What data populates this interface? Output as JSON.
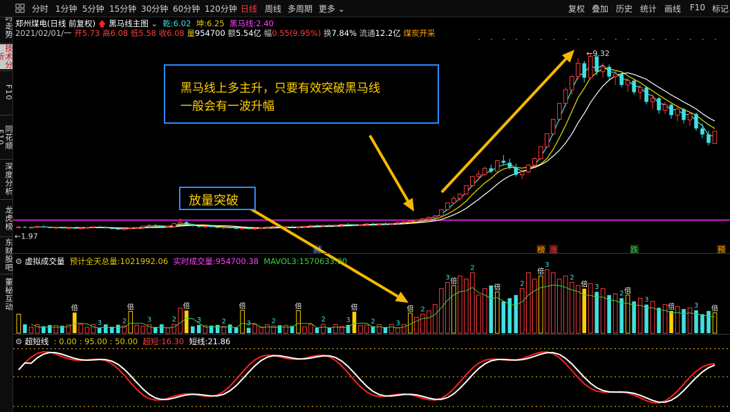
{
  "toolbar": {
    "items": [
      "分时",
      "1分钟",
      "5分钟",
      "15分钟",
      "30分钟",
      "60分钟",
      "120分钟",
      "日线",
      "周线",
      "多周期",
      "更多"
    ],
    "active": "日线",
    "right_items": [
      "复权",
      "叠加",
      "历史",
      "统计",
      "画线",
      "F10",
      "标记"
    ]
  },
  "leftnav": {
    "items": [
      "分时走势",
      "技术分析",
      "F10",
      "同花顺F10",
      "深度分析",
      "龙虎榜",
      "东财股吧",
      "董秘互动"
    ]
  },
  "stock": {
    "name": "郑州煤电",
    "mode": "(日线 前复权)",
    "indicator": "黑马线主图",
    "qian_label": "乾:",
    "qian": "6.02",
    "kun_label": "坤:",
    "kun": "6.25",
    "heima_label": "黑马线:",
    "heima": "2.40"
  },
  "quote": {
    "date": "2021/02/01/一",
    "open_label": "开",
    "open": "5.73",
    "high_label": "高",
    "high": "6.08",
    "low_label": "低",
    "low": "5.58",
    "close_label": "收",
    "close": "6.08",
    "vol_label": "量",
    "vol": "954700",
    "amt_label": "额",
    "amt": "5.54亿",
    "chg_label": "幅",
    "chg": "0.55(9.95%)",
    "turn_label": "换",
    "turn": "7.84%",
    "float_label": "流通",
    "float": "12.2亿",
    "sector": "煤炭开采"
  },
  "main_chart": {
    "high_label": "9.32",
    "low_label": "1.97",
    "markers": [
      "财",
      "榜",
      "涨",
      "跌",
      "预"
    ]
  },
  "callouts": {
    "big_line1": "黑马线上多主升，只要有效突破黑马线",
    "big_line2": "一般会有一波升幅",
    "small": "放量突破"
  },
  "volume_panel": {
    "title": "虚拟成交量",
    "est_label": "预计全天总量:",
    "est": "1021992.06",
    "rt_label": "实时成交量:",
    "rt": "954700.38",
    "mavol_label": "MAVOL3:",
    "mavol": "1570633.00",
    "mark_bei": "倍",
    "mark_3": "3",
    "mark_2": "2"
  },
  "cdx_panel": {
    "title": "超短线",
    "levels": ": 0.00 : 95.00 : 50.00",
    "cdx_label": "超短:",
    "cdx": "16.30",
    "dx_label": "短线:",
    "dx": "21.86"
  },
  "colors": {
    "up": "#ff3b3b",
    "down": "#3fe0e0",
    "heima": "#d020d0",
    "ma_fast": "#3fe0e0",
    "ma_slow": "#e6e600",
    "callout_border": "#2a8cff",
    "callout_text": "#ffd000",
    "arrow": "#f5b800"
  },
  "chart_data": {
    "type": "candlestick",
    "title": "郑州煤电 日线",
    "ohlc_series": [
      [
        2.1,
        2.14,
        2.06,
        2.12
      ],
      [
        2.12,
        2.15,
        2.08,
        2.09
      ],
      [
        2.09,
        2.13,
        2.05,
        2.11
      ],
      [
        2.11,
        2.16,
        2.08,
        2.14
      ],
      [
        2.14,
        2.18,
        2.1,
        2.12
      ],
      [
        2.12,
        2.14,
        2.06,
        2.08
      ],
      [
        2.08,
        2.12,
        2.03,
        2.1
      ],
      [
        2.1,
        2.13,
        2.05,
        2.07
      ],
      [
        2.07,
        2.11,
        2.02,
        2.09
      ],
      [
        2.09,
        2.12,
        2.04,
        2.06
      ],
      [
        2.06,
        2.1,
        2.01,
        2.08
      ],
      [
        2.08,
        2.12,
        2.04,
        2.1
      ],
      [
        2.1,
        2.14,
        2.06,
        2.13
      ],
      [
        2.13,
        2.17,
        2.09,
        2.11
      ],
      [
        2.11,
        2.14,
        2.05,
        2.07
      ],
      [
        2.07,
        2.1,
        2.02,
        2.05
      ],
      [
        2.05,
        2.08,
        1.99,
        2.03
      ],
      [
        2.03,
        2.07,
        1.97,
        2.05
      ],
      [
        2.05,
        2.09,
        2.01,
        2.08
      ],
      [
        2.08,
        2.12,
        2.04,
        2.1
      ],
      [
        2.1,
        2.18,
        2.08,
        2.16
      ],
      [
        2.16,
        2.22,
        2.12,
        2.19
      ],
      [
        2.19,
        2.24,
        2.14,
        2.17
      ],
      [
        2.17,
        2.2,
        2.1,
        2.12
      ],
      [
        2.12,
        2.16,
        2.08,
        2.14
      ],
      [
        2.14,
        2.28,
        2.12,
        2.26
      ],
      [
        2.26,
        2.48,
        2.22,
        2.32
      ],
      [
        2.32,
        2.36,
        2.18,
        2.21
      ],
      [
        2.21,
        2.25,
        2.14,
        2.16
      ],
      [
        2.16,
        2.19,
        2.1,
        2.13
      ],
      [
        2.13,
        2.17,
        2.08,
        2.15
      ],
      [
        2.15,
        2.19,
        2.1,
        2.12
      ],
      [
        2.12,
        2.15,
        2.06,
        2.09
      ],
      [
        2.09,
        2.13,
        2.04,
        2.11
      ],
      [
        2.11,
        2.14,
        2.06,
        2.08
      ],
      [
        2.08,
        2.11,
        2.02,
        2.05
      ],
      [
        2.05,
        2.09,
        2.0,
        2.07
      ],
      [
        2.07,
        2.1,
        2.02,
        2.04
      ],
      [
        2.04,
        2.08,
        1.99,
        2.06
      ],
      [
        2.06,
        2.1,
        2.02,
        2.09
      ],
      [
        2.09,
        2.13,
        2.05,
        2.12
      ],
      [
        2.12,
        2.16,
        2.08,
        2.14
      ],
      [
        2.14,
        2.18,
        2.1,
        2.11
      ],
      [
        2.11,
        2.15,
        2.06,
        2.13
      ],
      [
        2.13,
        2.17,
        2.08,
        2.1
      ],
      [
        2.1,
        2.14,
        2.05,
        2.12
      ],
      [
        2.12,
        2.16,
        2.08,
        2.15
      ],
      [
        2.15,
        2.2,
        2.11,
        2.18
      ],
      [
        2.18,
        2.22,
        2.13,
        2.16
      ],
      [
        2.16,
        2.2,
        2.11,
        2.19
      ],
      [
        2.19,
        2.23,
        2.14,
        2.17
      ],
      [
        2.17,
        2.21,
        2.12,
        2.2
      ],
      [
        2.2,
        2.25,
        2.16,
        2.23
      ],
      [
        2.23,
        2.28,
        2.18,
        2.21
      ],
      [
        2.21,
        2.25,
        2.16,
        2.19
      ],
      [
        2.19,
        2.23,
        2.14,
        2.22
      ],
      [
        2.22,
        2.27,
        2.18,
        2.25
      ],
      [
        2.25,
        2.3,
        2.2,
        2.23
      ],
      [
        2.23,
        2.28,
        2.18,
        2.26
      ],
      [
        2.26,
        2.31,
        2.21,
        2.24
      ],
      [
        2.24,
        2.29,
        2.19,
        2.27
      ],
      [
        2.27,
        2.33,
        2.22,
        2.3
      ],
      [
        2.3,
        2.36,
        2.25,
        2.33
      ],
      [
        2.33,
        2.4,
        2.28,
        2.37
      ],
      [
        2.37,
        2.45,
        2.32,
        2.42
      ],
      [
        2.42,
        2.5,
        2.36,
        2.46
      ],
      [
        2.46,
        2.56,
        2.4,
        2.52
      ],
      [
        2.52,
        2.62,
        2.46,
        2.58
      ],
      [
        2.58,
        2.84,
        2.55,
        2.84
      ],
      [
        2.84,
        3.12,
        2.8,
        3.12
      ],
      [
        3.12,
        3.4,
        3.05,
        3.3
      ],
      [
        3.3,
        3.52,
        3.2,
        3.48
      ],
      [
        3.48,
        3.85,
        3.45,
        3.83
      ],
      [
        3.83,
        4.2,
        3.78,
        4.21
      ],
      [
        4.21,
        4.45,
        4.05,
        4.3
      ],
      [
        4.3,
        4.62,
        4.22,
        4.55
      ],
      [
        4.55,
        4.7,
        4.35,
        4.42
      ],
      [
        4.42,
        4.9,
        4.38,
        4.86
      ],
      [
        4.86,
        5.1,
        4.7,
        4.78
      ],
      [
        4.78,
        4.95,
        4.5,
        4.6
      ],
      [
        4.6,
        4.75,
        4.2,
        4.28
      ],
      [
        4.28,
        4.5,
        4.1,
        4.4
      ],
      [
        4.4,
        4.72,
        4.35,
        4.68
      ],
      [
        4.68,
        5.0,
        4.6,
        4.95
      ],
      [
        4.95,
        5.45,
        4.9,
        5.44
      ],
      [
        5.44,
        5.98,
        5.4,
        5.98
      ],
      [
        5.98,
        6.58,
        5.92,
        6.58
      ],
      [
        6.58,
        7.24,
        6.5,
        7.24
      ],
      [
        7.24,
        7.9,
        7.1,
        7.8
      ],
      [
        7.8,
        8.4,
        7.6,
        8.35
      ],
      [
        8.35,
        9.1,
        8.2,
        8.9
      ],
      [
        8.9,
        9.0,
        8.1,
        8.3
      ],
      [
        8.3,
        9.32,
        8.25,
        9.18
      ],
      [
        9.18,
        9.25,
        8.4,
        8.55
      ],
      [
        8.55,
        8.9,
        8.3,
        8.75
      ],
      [
        8.75,
        8.85,
        8.2,
        8.35
      ],
      [
        8.35,
        8.6,
        8.0,
        8.45
      ],
      [
        8.45,
        8.55,
        7.9,
        8.0
      ],
      [
        8.0,
        8.3,
        7.7,
        8.18
      ],
      [
        8.18,
        8.25,
        7.6,
        7.7
      ],
      [
        7.7,
        8.0,
        7.4,
        7.9
      ],
      [
        7.9,
        7.95,
        7.2,
        7.3
      ],
      [
        7.3,
        7.6,
        7.0,
        7.45
      ],
      [
        7.45,
        7.5,
        6.8,
        6.95
      ],
      [
        6.95,
        7.3,
        6.8,
        7.18
      ],
      [
        7.18,
        7.22,
        6.6,
        6.75
      ],
      [
        6.75,
        7.1,
        6.5,
        7.0
      ],
      [
        7.0,
        7.05,
        6.4,
        6.55
      ],
      [
        6.55,
        6.9,
        6.3,
        6.8
      ],
      [
        6.8,
        6.85,
        6.1,
        6.2
      ],
      [
        6.2,
        6.4,
        5.8,
        5.95
      ],
      [
        5.95,
        6.1,
        5.5,
        5.6
      ],
      [
        5.58,
        6.08,
        5.58,
        6.08
      ]
    ],
    "heima_line": 2.4,
    "high_mark": 9.32,
    "low_mark": 1.97
  }
}
